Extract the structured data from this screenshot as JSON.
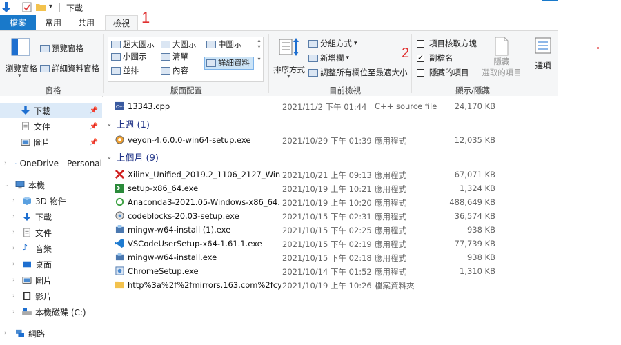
{
  "window": {
    "title": "下載"
  },
  "tabs": [
    {
      "label": "檔案"
    },
    {
      "label": "常用"
    },
    {
      "label": "共用"
    },
    {
      "label": "檢視"
    }
  ],
  "ribbon": {
    "panes": {
      "label": "窗格",
      "nav_pane": "瀏覽窗格",
      "preview_pane": "預覽窗格",
      "details_pane": "詳細資料窗格"
    },
    "layout": {
      "label": "版面配置",
      "items": [
        "超大圖示",
        "大圖示",
        "中圖示",
        "小圖示",
        "清單",
        "詳細資料",
        "並排",
        "內容"
      ]
    },
    "current_view": {
      "label": "目前檢視",
      "sort": "排序方式",
      "group_by": "分組方式",
      "add_columns": "新增欄",
      "fit_columns": "調整所有欄位至最適大小"
    },
    "show_hide": {
      "label": "顯示/隱藏",
      "item_checkboxes": "項目核取方塊",
      "extensions": "副檔名",
      "hidden_items": "隱藏的項目",
      "hide_selected_line1": "隱藏",
      "hide_selected_line2": "選取的項目"
    },
    "options": "選項"
  },
  "annotations": {
    "a1": "1",
    "a2": "2"
  },
  "nav": {
    "items": [
      {
        "label": "下載",
        "icon": "download-arrow-icon"
      },
      {
        "label": "文件",
        "icon": "document-icon"
      },
      {
        "label": "圖片",
        "icon": "pictures-icon"
      },
      {
        "label": "OneDrive - Personal",
        "icon": "cloud-icon"
      },
      {
        "label": "本機",
        "icon": "computer-icon"
      },
      {
        "label": "3D 物件",
        "icon": "cube-icon"
      },
      {
        "label": "下載",
        "icon": "download-arrow-icon"
      },
      {
        "label": "文件",
        "icon": "document-icon"
      },
      {
        "label": "音樂",
        "icon": "music-note-icon"
      },
      {
        "label": "桌面",
        "icon": "desktop-icon"
      },
      {
        "label": "圖片",
        "icon": "pictures-icon"
      },
      {
        "label": "影片",
        "icon": "video-icon"
      },
      {
        "label": "本機磁碟 (C:)",
        "icon": "drive-icon"
      },
      {
        "label": "網路",
        "icon": "network-icon"
      }
    ]
  },
  "files": {
    "top_row": {
      "name": "13343.cpp",
      "date": "2021/11/2 下午 01:44",
      "type": "C++ source file",
      "size": "24,170 KB"
    },
    "groups": [
      {
        "header": "上週 (1)",
        "rows": [
          {
            "name": "veyon-4.6.0.0-win64-setup.exe",
            "date": "2021/10/29 下午 01:39",
            "type": "應用程式",
            "size": "12,035 KB"
          }
        ]
      },
      {
        "header": "上個月 (9)",
        "rows": [
          {
            "name": "Xilinx_Unified_2019.2_1106_2127_Win...",
            "date": "2021/10/21 上午 09:13",
            "type": "應用程式",
            "size": "67,071 KB"
          },
          {
            "name": "setup-x86_64.exe",
            "date": "2021/10/19 上午 10:21",
            "type": "應用程式",
            "size": "1,324 KB"
          },
          {
            "name": "Anaconda3-2021.05-Windows-x86_64...",
            "date": "2021/10/19 上午 10:20",
            "type": "應用程式",
            "size": "488,649 KB"
          },
          {
            "name": "codeblocks-20.03-setup.exe",
            "date": "2021/10/15 下午 02:31",
            "type": "應用程式",
            "size": "36,574 KB"
          },
          {
            "name": "mingw-w64-install (1).exe",
            "date": "2021/10/15 下午 02:25",
            "type": "應用程式",
            "size": "938 KB"
          },
          {
            "name": "VSCodeUserSetup-x64-1.61.1.exe",
            "date": "2021/10/15 下午 02:19",
            "type": "應用程式",
            "size": "77,739 KB"
          },
          {
            "name": "mingw-w64-install.exe",
            "date": "2021/10/15 下午 02:18",
            "type": "應用程式",
            "size": "938 KB"
          },
          {
            "name": "ChromeSetup.exe",
            "date": "2021/10/14 下午 01:52",
            "type": "應用程式",
            "size": "1,310 KB"
          },
          {
            "name": "http%3a%2f%2fmirrors.163.com%2fcy...",
            "date": "2021/10/19 上午 10:26",
            "type": "檔案資料夾",
            "size": ""
          }
        ]
      }
    ]
  },
  "colors": {
    "accent": "#1979ca",
    "group_header": "#1e3287",
    "annotation": "#e03030",
    "selection": "#cce4f7"
  }
}
